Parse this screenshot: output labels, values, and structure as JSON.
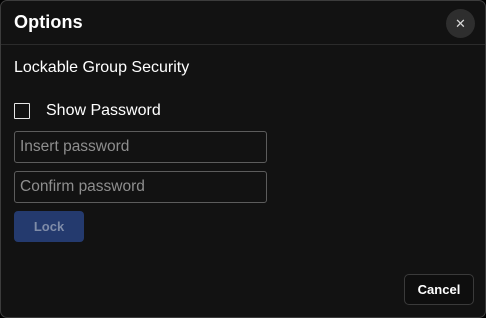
{
  "dialog": {
    "title": "Options",
    "close_icon": "close-icon",
    "close_glyph": "✕"
  },
  "section": {
    "title": "Lockable Group Security"
  },
  "show_password": {
    "label": "Show Password",
    "checked": false
  },
  "password_field": {
    "value": "",
    "placeholder": "Insert password"
  },
  "confirm_field": {
    "value": "",
    "placeholder": "Confirm password"
  },
  "lock_button": {
    "label": "Lock",
    "enabled": false
  },
  "cancel_button": {
    "label": "Cancel"
  },
  "colors": {
    "background": "#121212",
    "border": "#3c3c3c",
    "lock_button_bg": "#243a6e",
    "text": "#ffffff",
    "placeholder": "#8e8e8e"
  }
}
